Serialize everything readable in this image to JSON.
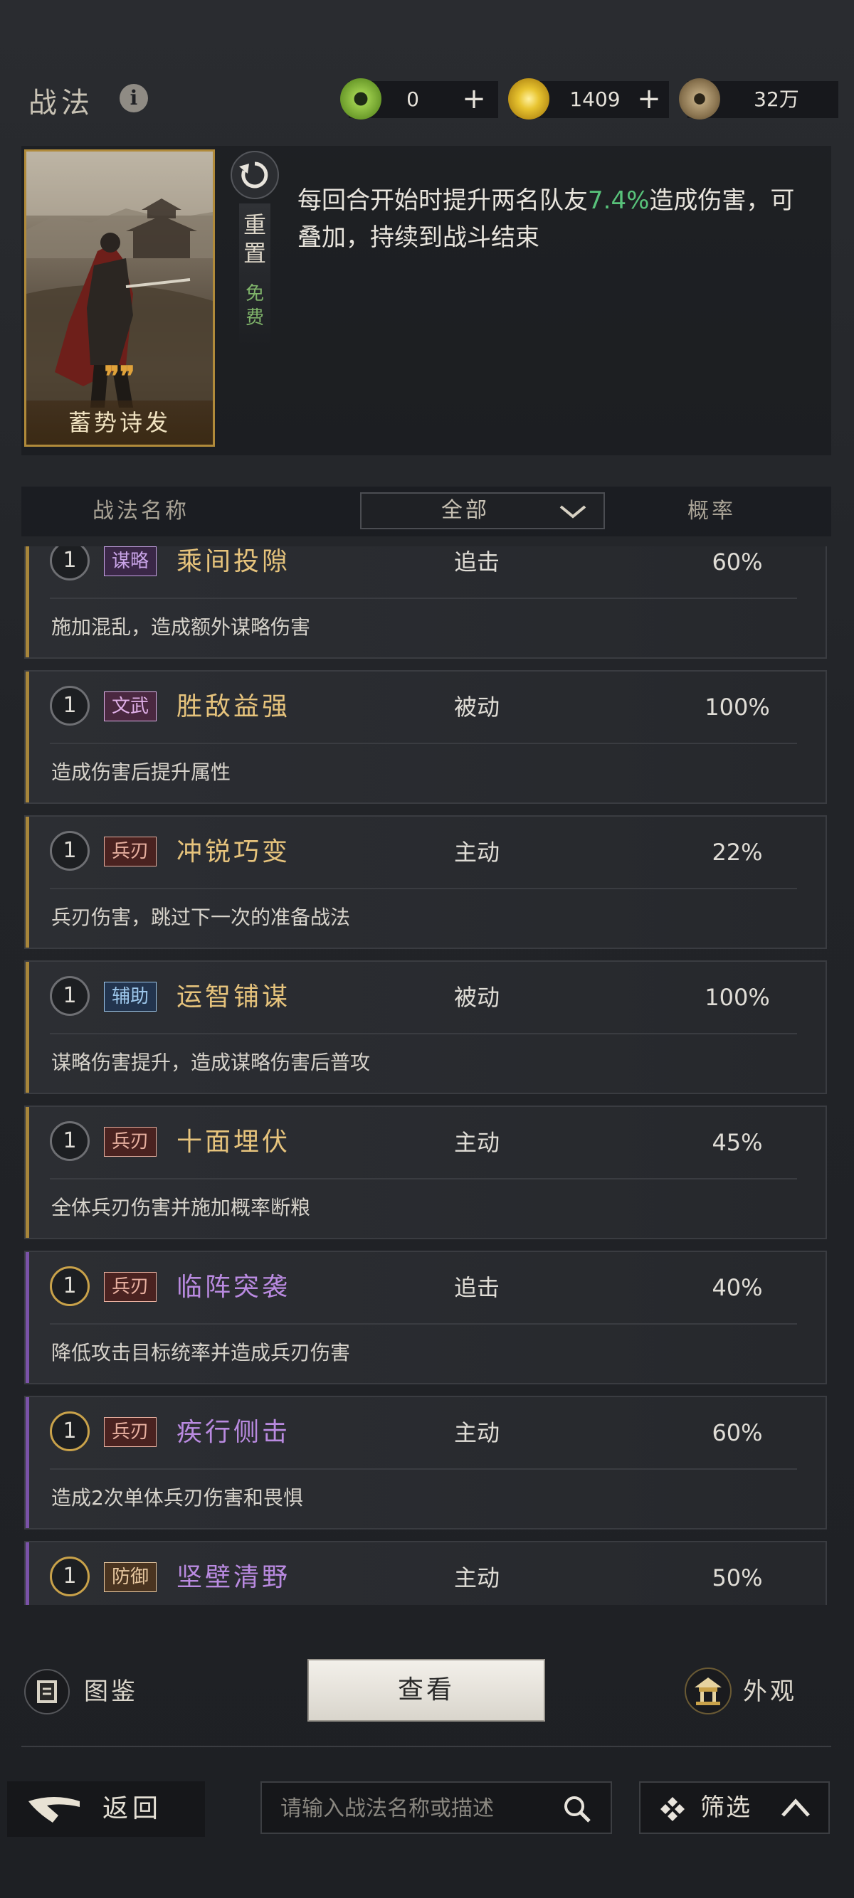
{
  "header": {
    "title": "战法",
    "currencies": [
      {
        "name": "jade-coin",
        "value": "0",
        "color": "#7cae3a"
      },
      {
        "name": "gold-coin",
        "value": "1409",
        "color": "#d6b02c"
      },
      {
        "name": "copper-coin",
        "value": "32万",
        "color": "#8a7a58"
      }
    ],
    "plus": "+"
  },
  "selected_skill": {
    "card_name": "蓄势诗发",
    "reset_label": "重置",
    "free_label": "免费",
    "desc_before": "每回合开始时提升两名队友",
    "desc_highlight": "7.4%",
    "desc_after": "造成伤害，可叠加，持续到战斗结束"
  },
  "table_header": {
    "name": "战法名称",
    "filter": "全部",
    "rate": "概率"
  },
  "skills": [
    {
      "level": "1",
      "tag": "谋略",
      "name": "乘间投隙",
      "type": "追击",
      "rate": "60%",
      "desc": "施加混乱，造成额外谋略伤害"
    },
    {
      "level": "1",
      "tag": "文武",
      "name": "胜敌益强",
      "type": "被动",
      "rate": "100%",
      "desc": "造成伤害后提升属性"
    },
    {
      "level": "1",
      "tag": "兵刃",
      "name": "冲锐巧变",
      "type": "主动",
      "rate": "22%",
      "desc": "兵刃伤害，跳过下一次的准备战法"
    },
    {
      "level": "1",
      "tag": "辅助",
      "name": "运智铺谋",
      "type": "被动",
      "rate": "100%",
      "desc": "谋略伤害提升，造成谋略伤害后普攻"
    },
    {
      "level": "1",
      "tag": "兵刃",
      "name": "十面埋伏",
      "type": "主动",
      "rate": "45%",
      "desc": "全体兵刃伤害并施加概率断粮"
    },
    {
      "level": "1",
      "tag": "兵刃",
      "name": "临阵突袭",
      "type": "追击",
      "rate": "40%",
      "desc": "降低攻击目标统率并造成兵刃伤害"
    },
    {
      "level": "1",
      "tag": "兵刃",
      "name": "疾行侧击",
      "type": "主动",
      "rate": "60%",
      "desc": "造成2次单体兵刃伤害和畏惧"
    },
    {
      "level": "1",
      "tag": "防御",
      "name": "坚壁清野",
      "type": "主动",
      "rate": "50%",
      "desc": ""
    }
  ],
  "actions": {
    "tujian": "图鉴",
    "view": "查看",
    "appearance": "外观"
  },
  "bottom_bar": {
    "back": "返回",
    "search_placeholder": "请输入战法名称或描述",
    "filter": "筛选"
  },
  "colors": {
    "gold_name": "#e6c37c",
    "purple_name": "#b98ae0",
    "highlight_green": "#58c27a"
  }
}
